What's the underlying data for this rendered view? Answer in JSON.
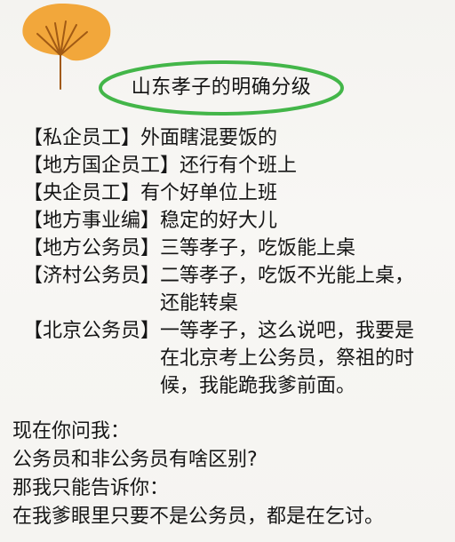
{
  "icon": {
    "leaf": "ginkgo-leaf-icon",
    "leaf_color": "#f2a73b",
    "vein_color": "#a15a14"
  },
  "title": {
    "text": "山东孝子的明确分级",
    "ring_color": "#43b649"
  },
  "grades": [
    {
      "category": "【私企员工】",
      "lines": [
        "外面瞎混要饭的"
      ]
    },
    {
      "category": "【地方国企员工】",
      "lines": [
        "还行有个班上"
      ]
    },
    {
      "category": "【央企员工】",
      "lines": [
        "有个好单位上班"
      ]
    },
    {
      "category": "【地方事业编】",
      "lines": [
        "稳定的好大儿"
      ]
    },
    {
      "category": "【地方公务员】",
      "lines": [
        "三等孝子，吃饭能上桌"
      ]
    },
    {
      "category": "【济村公务员】",
      "lines": [
        "二等孝子，吃饭不光能上桌，",
        "还能转桌"
      ]
    },
    {
      "category": "【北京公务员】",
      "lines": [
        "一等孝子，这么说吧，我要是",
        "在北京考上公务员，祭祖的时",
        "候，我能跪我爹前面。"
      ]
    }
  ],
  "closing": [
    "现在你问我：",
    "公务员和非公务员有啥区别?",
    "那我只能告诉你：",
    "在我爹眼里只要不是公务员，都是在乞讨。"
  ]
}
